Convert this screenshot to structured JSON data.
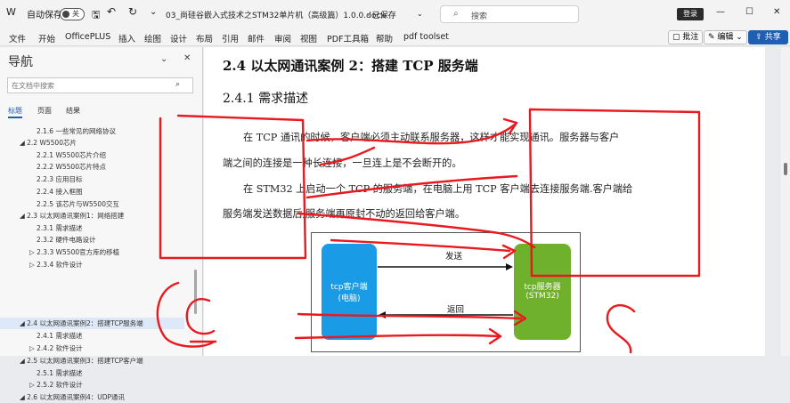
{
  "titlebar": {
    "autosave_label": "自动保存",
    "autosave_state": "关",
    "filename": "03_尚硅谷嵌入式技术之STM32单片机（高级篇）1.0.0.docx",
    "saved_status": "· 已保存",
    "search_placeholder": "搜索",
    "login_label": "登录"
  },
  "menu": {
    "items": [
      "文件",
      "开始",
      "OfficePLUS",
      "插入",
      "绘图",
      "设计",
      "布局",
      "引用",
      "邮件",
      "审阅",
      "视图",
      "PDF工具箱",
      "帮助",
      "pdf toolset"
    ],
    "comment_btn": "批注",
    "edit_btn": "编辑",
    "share_btn": "共享"
  },
  "nav": {
    "title": "导航",
    "search_placeholder": "在文档中搜索",
    "tabs": [
      "标题",
      "页面",
      "结果"
    ],
    "items": [
      {
        "text": "2.1.6 一些常见的网络协议"
      },
      {
        "text": "2.2 W5500芯片"
      },
      {
        "text": "2.2.1 W5500芯片介绍"
      },
      {
        "text": "2.2.2 W5500芯片特点"
      },
      {
        "text": "2.2.3 应用目标"
      },
      {
        "text": "2.2.4 接入框图"
      },
      {
        "text": "2.2.5 该芯片与W5500交互"
      },
      {
        "text": "2.3 以太网通讯案例1：网络搭建"
      },
      {
        "text": "2.3.1 需求描述"
      },
      {
        "text": "2.3.2 硬件电路设计"
      },
      {
        "text": "2.3.3 W5500官方库的移植"
      },
      {
        "text": "2.3.4 软件设计"
      },
      {
        "text": "2.4 以太网通讯案例2：搭建TCP服务端"
      },
      {
        "text": "2.4.1 需求描述"
      },
      {
        "text": "2.4.2 软件设计"
      },
      {
        "text": "2.5 以太网通讯案例3：搭建TCP客户端"
      },
      {
        "text": "2.5.1 需求描述"
      },
      {
        "text": "2.5.2 软件设计"
      },
      {
        "text": "2.6 以太网通讯案例4：UDP通讯"
      }
    ]
  },
  "doc": {
    "heading2": "2.4 以太网通讯案例 2：搭建 TCP 服务端",
    "heading3": "2.4.1 需求描述",
    "p1_line1": "在 TCP 通讯的时候，客户端必须主动联系服务器，这样才能实现通讯。服务器与客户",
    "p1_line2": "端之间的连接是一种长连接，一旦连上是不会断开的。",
    "p2_line1": "在 STM32 上启动一个 TCP 的服务端，在电脑上用 TCP 客户端去连接服务端.客户端给",
    "p2_line2": "服务端发送数据后,服务端再原封不动的返回给客户端。",
    "diagram": {
      "left_box_line1": "tcp客户端",
      "left_box_line2": "(电脑)",
      "right_box_line1": "tcp服务器",
      "right_box_line2": "(STM32)",
      "send_label": "发送",
      "return_label": "返回"
    }
  },
  "colors": {
    "annotation_red": "#e8191f",
    "client_blue": "#1a9be6",
    "server_green": "#6fb02c",
    "accent": "#1e5fb3"
  }
}
